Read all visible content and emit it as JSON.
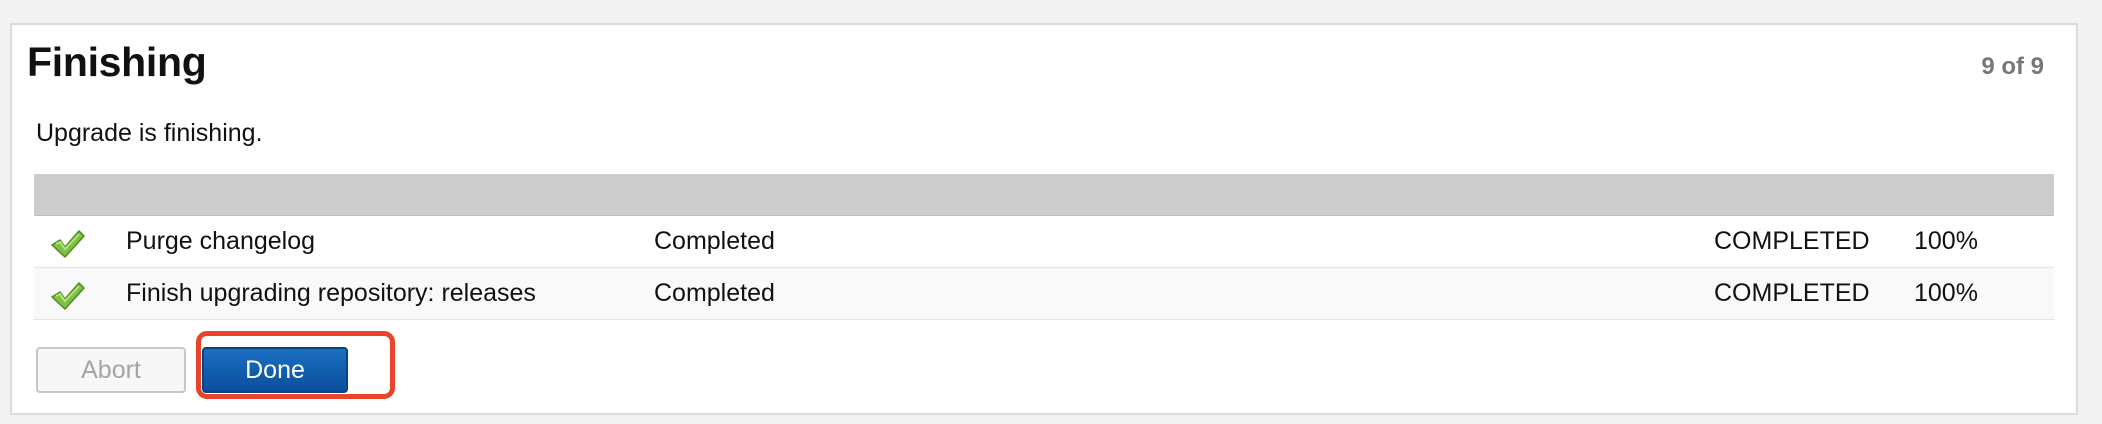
{
  "header": {
    "title": "Finishing",
    "step_count": "9 of 9"
  },
  "message": "Upgrade is finishing.",
  "tasks": [
    {
      "icon": "check-icon",
      "name": "Purge changelog",
      "status": "Completed",
      "state": "COMPLETED",
      "percent": "100%"
    },
    {
      "icon": "check-icon",
      "name": "Finish upgrading repository: releases",
      "status": "Completed",
      "state": "COMPLETED",
      "percent": "100%"
    }
  ],
  "buttons": {
    "abort_label": "Abort",
    "done_label": "Done"
  },
  "colors": {
    "primary_button": "#1b6fc2",
    "highlight": "#e8432b",
    "check_green": "#7dc242",
    "table_header": "#cccccc"
  }
}
